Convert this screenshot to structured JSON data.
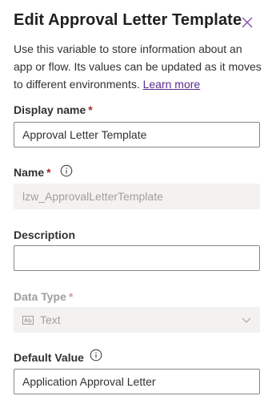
{
  "panel": {
    "title": "Edit Approval Letter Template",
    "description": "Use this variable to store information about an app or flow. Its values can be updated as it moves to different environments.",
    "learn_more": "Learn more"
  },
  "fields": {
    "display_name": {
      "label": "Display name",
      "required": "*",
      "value": "Approval Letter Template"
    },
    "name": {
      "label": "Name",
      "required": "*",
      "value": "lzw_ApprovalLetterTemplate"
    },
    "description": {
      "label": "Description",
      "value": ""
    },
    "data_type": {
      "label": "Data Type",
      "required": "*",
      "value": "Text"
    },
    "default_value": {
      "label": "Default Value",
      "value": "Application Approval Letter"
    }
  },
  "icons": {
    "close": "close-icon",
    "info": "info-icon",
    "text_type": "text-type-icon",
    "chevron": "chevron-down-icon"
  },
  "colors": {
    "link": "#5b2c8b",
    "required": "#a4262c",
    "close": "#8a4bb0"
  }
}
